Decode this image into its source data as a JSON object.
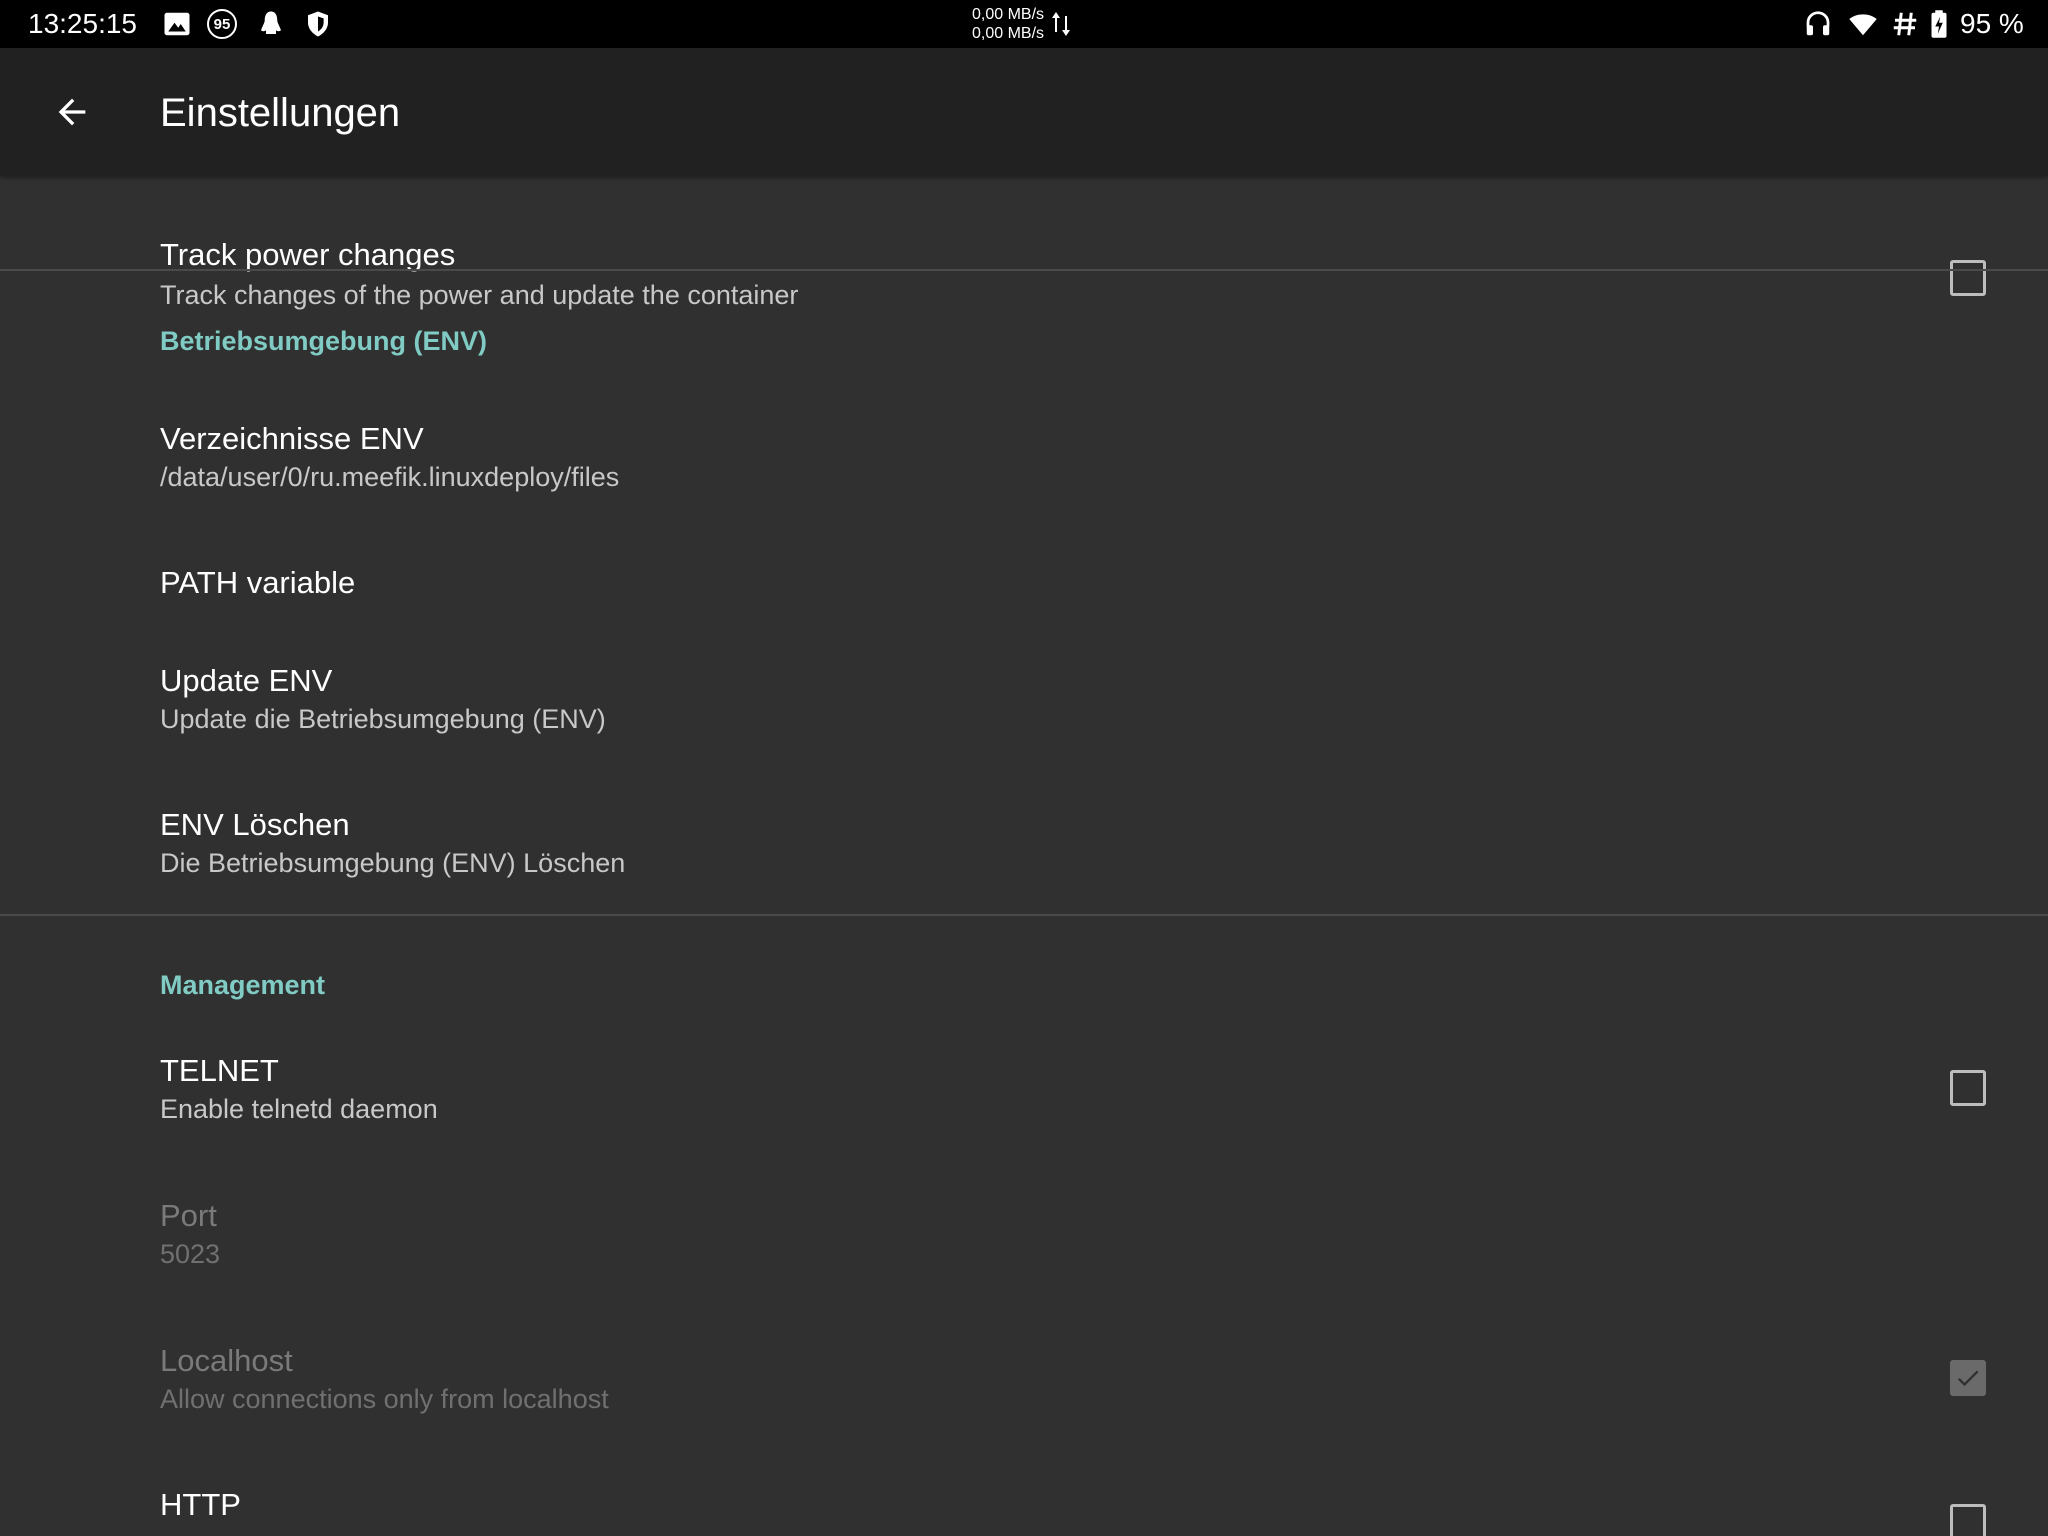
{
  "status_bar": {
    "time": "13:25:15",
    "notification_badge": "95",
    "net_up": "0,00 MB/s",
    "net_down": "0,00 MB/s",
    "battery_percent": "95 %",
    "left_icons": [
      "image-icon",
      "badge-icon",
      "linux-icon",
      "shield-icon"
    ],
    "right_icons": [
      "headphones-icon",
      "wifi-icon",
      "hash-icon",
      "battery-icon"
    ]
  },
  "app_bar": {
    "title": "Einstellungen",
    "back_icon": "arrow-back-icon"
  },
  "preferences": {
    "track_power": {
      "title": "Track power changes",
      "summary": "Track changes of the power and update the container",
      "checked": false
    },
    "env_category": "Betriebsumgebung (ENV)",
    "env_dir": {
      "title": "Verzeichnisse ENV",
      "summary": "/data/user/0/ru.meefik.linuxdeploy/files"
    },
    "path_variable": {
      "title": "PATH variable"
    },
    "update_env": {
      "title": "Update ENV",
      "summary": "Update die Betriebsumgebung (ENV)"
    },
    "delete_env": {
      "title": "ENV Löschen",
      "summary": "Die Betriebsumgebung (ENV) Löschen"
    },
    "management_category": "Management",
    "telnet": {
      "title": "TELNET",
      "summary": "Enable telnetd daemon",
      "checked": false
    },
    "port": {
      "title": "Port",
      "summary": "5023",
      "enabled": false
    },
    "localhost": {
      "title": "Localhost",
      "summary": "Allow connections only from localhost",
      "checked": true,
      "enabled": false
    },
    "http": {
      "title": "HTTP",
      "checked": false
    }
  },
  "colors": {
    "background": "#303030",
    "app_bar": "#212121",
    "status_bar": "#000000",
    "accent": "#80cbc4"
  }
}
